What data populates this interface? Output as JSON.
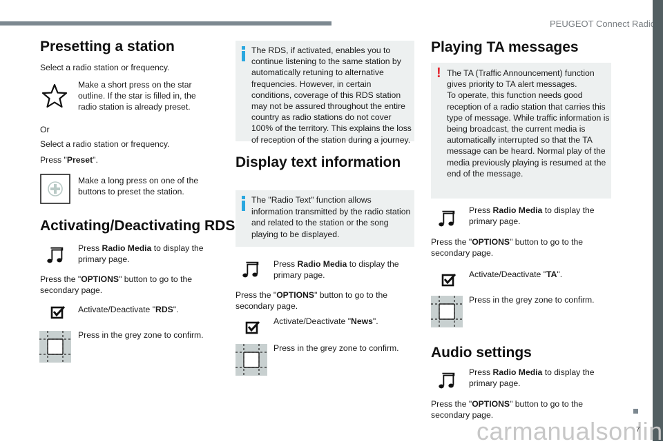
{
  "header": {
    "title": "PEUGEOT Connect Radio"
  },
  "footer": {
    "page_number": "7",
    "watermark": "carmanualsonline.info"
  },
  "col1": {
    "presetting": {
      "title": "Presetting a station",
      "select1": "Select a radio station or frequency.",
      "star_text": "Make a short press on the star outline. If the star is filled in, the radio station is already preset.",
      "or": "Or",
      "select2": "Select a radio station or frequency.",
      "press_pre": "Press \"",
      "press_bold": "Preset",
      "press_post": "\".",
      "long_press_text": "Make a long press on one of the buttons to preset the station."
    },
    "rds": {
      "title": "Activating/Deactivating RDS",
      "press_pre": "Press ",
      "press_bold": "Radio Media",
      "press_post": " to display the primary page.",
      "options_pre": "Press the \"",
      "options_bold": "OPTIONS",
      "options_post": "\" button to go to the secondary page.",
      "activate_pre": "Activate/Deactivate \"",
      "activate_bold": "RDS",
      "activate_post": "\".",
      "confirm": "Press in the grey zone to confirm."
    }
  },
  "col2": {
    "rds_info": "The RDS, if activated, enables you to continue listening to the same station by automatically retuning to alternative frequencies. However, in certain conditions, coverage of this RDS station may not be assured throughout the entire country as radio stations do not cover 100% of the territory. This explains the loss of reception of the station during a journey.",
    "display_text": {
      "title": "Display text information",
      "info": "The \"Radio Text\" function allows information transmitted by the radio station and related to the station or the song playing to be displayed.",
      "press_pre": "Press ",
      "press_bold": "Radio Media",
      "press_post": " to display the primary page.",
      "options_pre": "Press the \"",
      "options_bold": "OPTIONS",
      "options_post": "\" button to go to the secondary page.",
      "activate_pre": "Activate/Deactivate \"",
      "activate_bold": "News",
      "activate_post": "\".",
      "confirm": "Press in the grey zone to confirm."
    }
  },
  "col3": {
    "ta": {
      "title": "Playing TA messages",
      "warning": "The TA (Traffic Announcement) function gives priority to TA alert messages.\nTo operate, this function needs good reception of a radio station that carries this type of message. While traffic information is being broadcast, the current media is automatically interrupted so that the TA message can be heard. Normal play of the media previously playing is resumed at the end of the message.",
      "press_pre": "Press ",
      "press_bold": "Radio Media",
      "press_post": " to display the primary page.",
      "options_pre": "Press the \"",
      "options_bold": "OPTIONS",
      "options_post": "\" button to go to the secondary page.",
      "activate_pre": "Activate/Deactivate \"",
      "activate_bold": "TA",
      "activate_post": "\".",
      "confirm": "Press in the grey zone to confirm."
    },
    "audio": {
      "title": "Audio settings",
      "press_pre": "Press ",
      "press_bold": "Radio Media",
      "press_post": " to display the primary page.",
      "options_pre": "Press the \"",
      "options_bold": "OPTIONS",
      "options_post": "\" button to go to the secondary page."
    }
  },
  "colors": {
    "info_accent": "#29a7df",
    "warning_accent": "#e4262f",
    "box_bg": "#edf0f0",
    "side_band": "#535f62"
  }
}
